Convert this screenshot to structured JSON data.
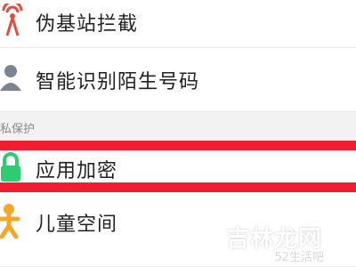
{
  "settings": {
    "items": [
      {
        "label": "伪基站拦截",
        "icon": "tower-signal-icon"
      },
      {
        "label": "智能识别陌生号码",
        "icon": "person-icon"
      },
      {
        "label": "应用加密",
        "icon": "lock-icon"
      },
      {
        "label": "儿童空间",
        "icon": "child-icon"
      }
    ],
    "section_header": "私保护"
  },
  "watermark": {
    "main": "吉林龙网",
    "sub": "52生活吧",
    "logo": "watermark-logo-icon"
  },
  "colors": {
    "highlight": "#f01e2e",
    "lock_icon": "#2ecc71",
    "child_icon": "#f5a623",
    "tower_icon": "#e84a3a",
    "person_icon": "#7a8590"
  }
}
